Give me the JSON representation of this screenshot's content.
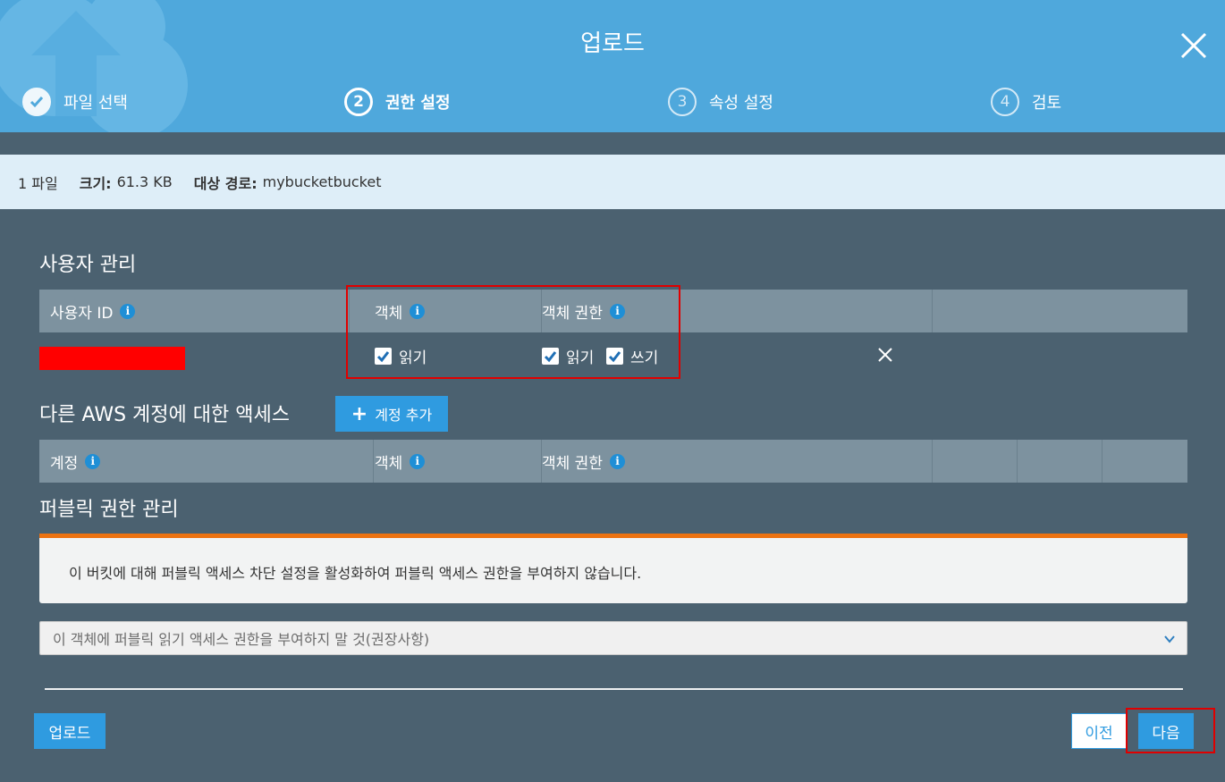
{
  "dialog": {
    "title": "업로드"
  },
  "steps": [
    {
      "number": "",
      "label": "파일 선택",
      "state": "done"
    },
    {
      "number": "2",
      "label": "권한 설정",
      "state": "active"
    },
    {
      "number": "3",
      "label": "속성 설정",
      "state": "pending"
    },
    {
      "number": "4",
      "label": "검토",
      "state": "pending"
    }
  ],
  "infobar": {
    "file_count": "1 파일",
    "size_label": "크기:",
    "size_value": "61.3 KB",
    "target_label": "대상 경로:",
    "target_value": "mybucketbucket"
  },
  "user_management": {
    "title": "사용자 관리",
    "columns": {
      "user_id": "사용자 ID",
      "object": "객체",
      "object_permissions": "객체 권한"
    },
    "row": {
      "object_read_label": "읽기",
      "object_read_checked": true,
      "perm_read_label": "읽기",
      "perm_read_checked": true,
      "perm_write_label": "쓰기",
      "perm_write_checked": true
    }
  },
  "other_accounts": {
    "title": "다른 AWS 계정에 대한 액세스",
    "add_button": "계정 추가",
    "columns": {
      "account": "계정",
      "object": "객체",
      "object_permissions": "객체 권한"
    }
  },
  "public_permissions": {
    "title": "퍼블릭 권한 관리",
    "alert_text": "이 버킷에 대해 퍼블릭 액세스 차단 설정을 활성화하여 퍼블릭 액세스 권한을 부여하지 않습니다.",
    "select_value": "이 객체에 퍼블릭 읽기 액세스 권한을 부여하지 말 것(권장사항)"
  },
  "footer": {
    "upload_label": "업로드",
    "prev_label": "이전",
    "next_label": "다음"
  },
  "colors": {
    "header_bg": "#4fa8dc",
    "body_bg": "#4b6170",
    "primary_button": "#2f9be0",
    "highlight_border": "#e00000",
    "alert_accent": "#ec7211"
  }
}
